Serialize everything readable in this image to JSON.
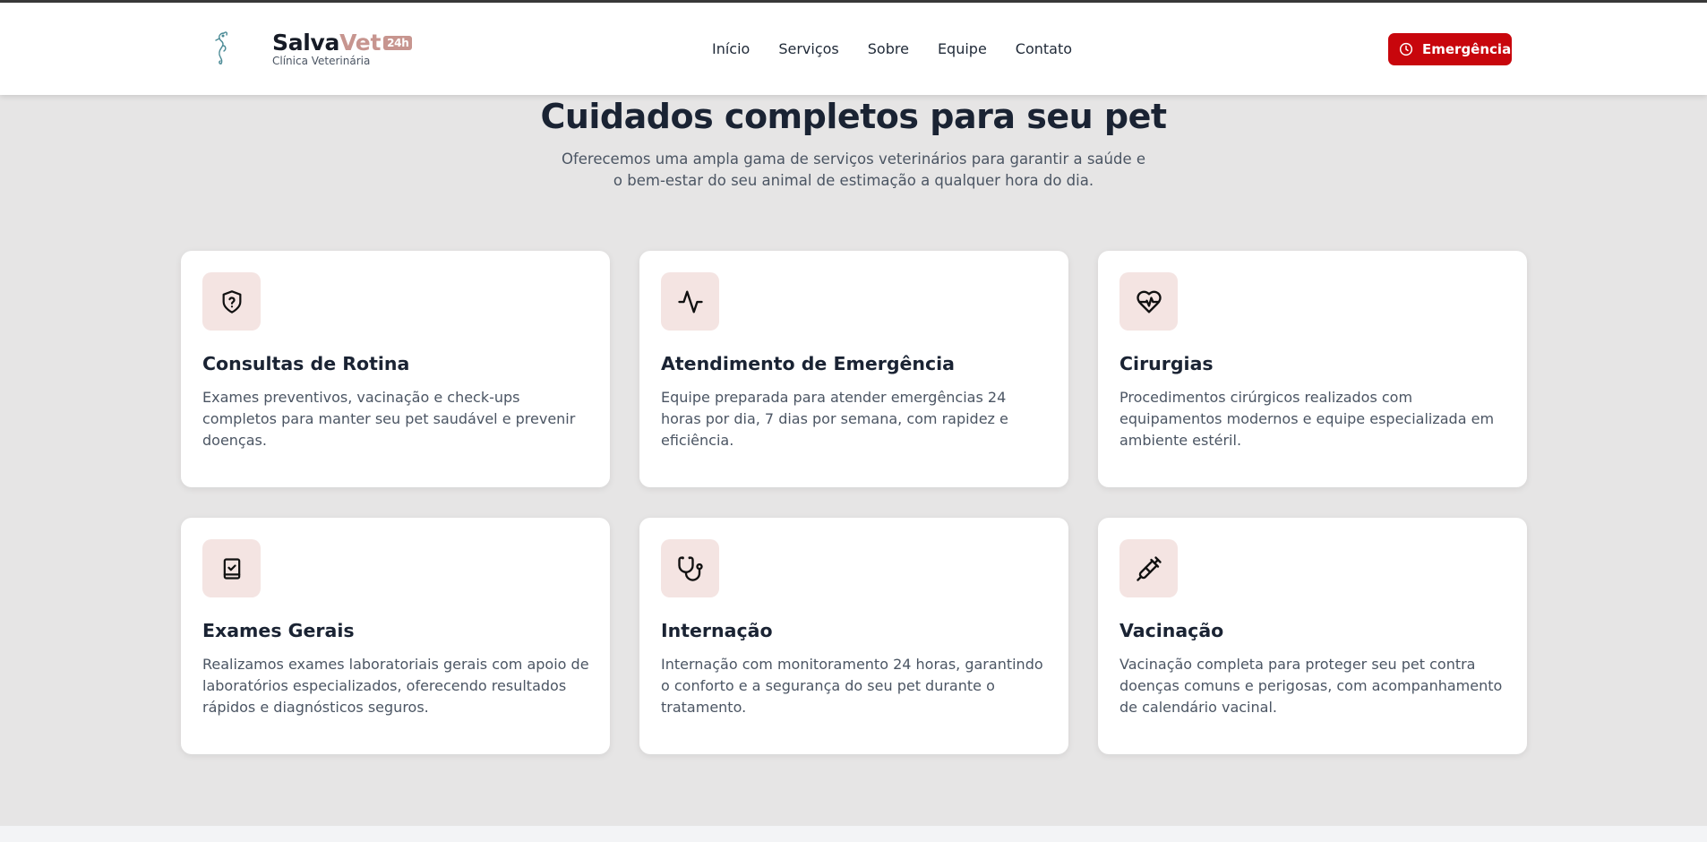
{
  "brand": {
    "name_part1": "Salva",
    "name_part2": "Vet",
    "badge": "24h",
    "subtitle": "Clínica Veterinária"
  },
  "nav": {
    "items": [
      {
        "label": "Início"
      },
      {
        "label": "Serviços"
      },
      {
        "label": "Sobre"
      },
      {
        "label": "Equipe"
      },
      {
        "label": "Contato"
      }
    ]
  },
  "emergency_button": {
    "label": "Emergência",
    "icon": "clock-icon"
  },
  "services": {
    "title": "Cuidados completos para seu pet",
    "subtitle": "Oferecemos uma ampla gama de serviços veterinários para garantir a saúde e o bem-estar do seu animal de estimação a qualquer hora do dia.",
    "cards": [
      {
        "title": "Consultas de Rotina",
        "description": "Exames preventivos, vacinação e check-ups completos para manter seu pet saudável e prevenir doenças.",
        "icon": "shield-question-icon"
      },
      {
        "title": "Atendimento de Emergência",
        "description": "Equipe preparada para atender emergências 24 horas por dia, 7 dias por semana, com rapidez e eficiência.",
        "icon": "activity-icon"
      },
      {
        "title": "Cirurgias",
        "description": "Procedimentos cirúrgicos realizados com equipamentos modernos e equipe especializada em ambiente estéril.",
        "icon": "heart-pulse-icon"
      },
      {
        "title": "Exames Gerais",
        "description": "Realizamos exames laboratoriais gerais com apoio de laboratórios especializados, oferecendo resultados rápidos e diagnósticos seguros.",
        "icon": "clipboard-check-icon"
      },
      {
        "title": "Internação",
        "description": "Internação com monitoramento 24 horas, garantindo o conforto e a segurança do seu pet durante o tratamento.",
        "icon": "stethoscope-icon"
      },
      {
        "title": "Vacinação",
        "description": "Vacinação completa para proteger seu pet contra doenças comuns e perigosas, com acompanhamento de calendário vacinal.",
        "icon": "syringe-icon"
      }
    ]
  },
  "colors": {
    "brand_accent": "#c7958f",
    "emergency_red": "#c8060c",
    "icon_bg": "#f4e4e2",
    "page_bg": "#e6e5e5"
  }
}
